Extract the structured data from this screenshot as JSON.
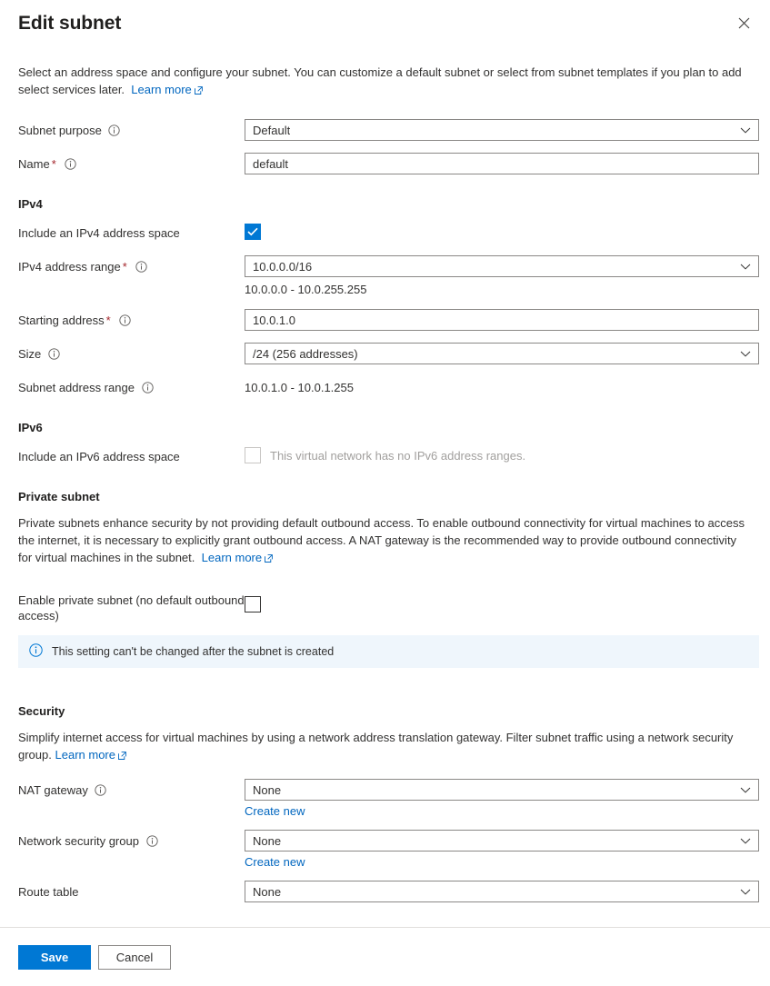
{
  "header": {
    "title": "Edit subnet",
    "close_icon": "close-icon"
  },
  "intro": {
    "text": "Select an address space and configure your subnet. You can customize a default subnet or select from subnet templates if you plan to add select services later.",
    "learn_more": "Learn more"
  },
  "form": {
    "subnet_purpose": {
      "label": "Subnet purpose",
      "value": "Default"
    },
    "name": {
      "label": "Name",
      "required": "*",
      "value": "default"
    }
  },
  "ipv4": {
    "heading": "IPv4",
    "include": {
      "label": "Include an IPv4 address space",
      "checked": true
    },
    "address_range": {
      "label": "IPv4 address range",
      "required": "*",
      "value": "10.0.0.0/16",
      "helper": "10.0.0.0 - 10.0.255.255"
    },
    "starting_address": {
      "label": "Starting address",
      "required": "*",
      "value": "10.0.1.0"
    },
    "size": {
      "label": "Size",
      "value": "/24 (256 addresses)"
    },
    "subnet_address_range": {
      "label": "Subnet address range",
      "value": "10.0.1.0 - 10.0.1.255"
    }
  },
  "ipv6": {
    "heading": "IPv6",
    "include": {
      "label": "Include an IPv6 address space",
      "note": "This virtual network has no IPv6 address ranges.",
      "checked": false,
      "disabled": true
    }
  },
  "private_subnet": {
    "heading": "Private subnet",
    "description": "Private subnets enhance security by not providing default outbound access. To enable outbound connectivity for virtual machines to access the internet, it is necessary to explicitly grant outbound access. A NAT gateway is the recommended way to provide outbound connectivity for virtual machines in the subnet.",
    "learn_more": "Learn more",
    "enable": {
      "label": "Enable private subnet (no default outbound access)",
      "checked": false
    },
    "banner": "This setting can't be changed after the subnet is created"
  },
  "security": {
    "heading": "Security",
    "description": "Simplify internet access for virtual machines by using a network address translation gateway. Filter subnet traffic using a network security group.",
    "learn_more": "Learn more",
    "nat_gateway": {
      "label": "NAT gateway",
      "value": "None",
      "create_new": "Create new"
    },
    "network_security_group": {
      "label": "Network security group",
      "value": "None",
      "create_new": "Create new"
    },
    "route_table": {
      "label": "Route table",
      "value": "None"
    }
  },
  "footer": {
    "save": "Save",
    "cancel": "Cancel"
  },
  "colors": {
    "accent": "#0078d4",
    "link": "#0066bf",
    "required": "#a4262c",
    "banner_bg": "#eff6fc",
    "border": "#8a8886"
  }
}
